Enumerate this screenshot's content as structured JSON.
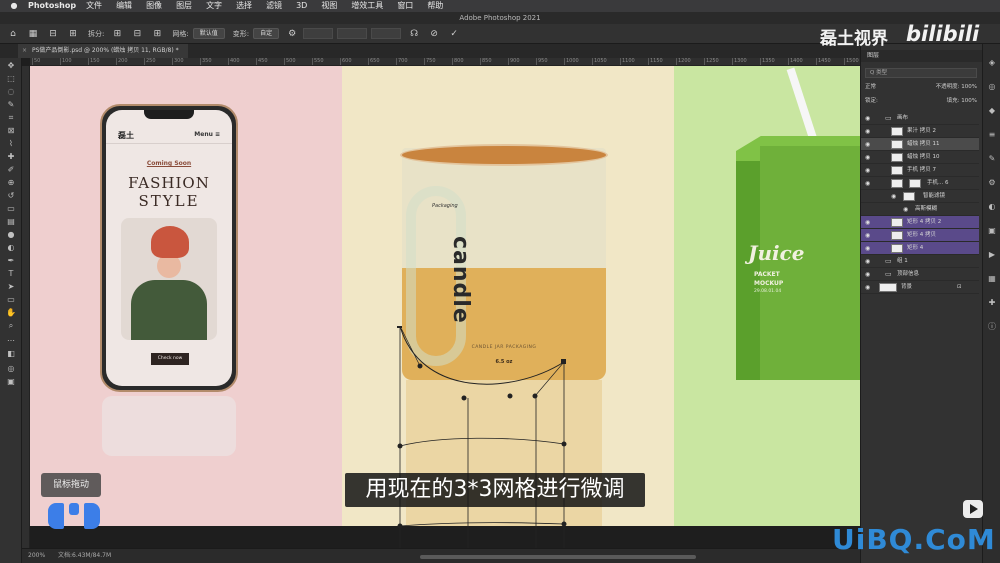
{
  "macbar": {
    "apple": "",
    "app": "Photoshop",
    "menus": [
      "文件",
      "编辑",
      "图像",
      "图层",
      "文字",
      "选择",
      "滤镜",
      "3D",
      "视图",
      "增效工具",
      "窗口",
      "帮助"
    ]
  },
  "window_title": "Adobe Photoshop 2021",
  "options": {
    "split_label": "拆分:",
    "grid_label": "网格:",
    "grid_value": "默认值",
    "warp_label": "变形:",
    "warp_value": "自定"
  },
  "doc_tab": {
    "close": "×",
    "title": "PS做产品倒影.psd @ 200% (蜡烛 拷贝 11, RGB/8) *"
  },
  "ruler_ticks": [
    "50",
    "100",
    "150",
    "200",
    "250",
    "300",
    "350",
    "400",
    "450",
    "500",
    "550",
    "600",
    "650",
    "700",
    "750",
    "800",
    "850",
    "900",
    "950",
    "1000",
    "1050",
    "1100",
    "1150",
    "1200",
    "1250",
    "1300",
    "1350",
    "1400",
    "1450",
    "1500"
  ],
  "phone": {
    "brand": "磊土",
    "menu": "Menu ≡",
    "coming": "Coming Soon",
    "title1": "FASHION",
    "title2": "STYLE",
    "button": "Check now"
  },
  "candle": {
    "script": "Packaging",
    "word": "candle",
    "pack_text": "CANDLE JAR PACKAGING",
    "oz": "6.5 oz"
  },
  "juice": {
    "title": "Juice",
    "sub1": "PACKET",
    "sub2": "MOCKUP",
    "sub3": "29.08.01.04"
  },
  "layers_panel": {
    "title": "图层",
    "search": "Q 类型",
    "blend": "正常",
    "opacity": "不透明度: 100%",
    "lock": "锁定:",
    "fill": "填充: 100%",
    "layers": [
      {
        "name": "画布",
        "kind": "group",
        "state": ""
      },
      {
        "name": "果汁 拷贝 2",
        "kind": "layer",
        "state": ""
      },
      {
        "name": "蜡烛 拷贝 11",
        "kind": "layer",
        "state": "selected"
      },
      {
        "name": "蜡烛 拷贝 10",
        "kind": "layer",
        "state": ""
      },
      {
        "name": "手机 拷贝 7",
        "kind": "layer",
        "state": ""
      },
      {
        "name": "手机... 6",
        "kind": "layer",
        "state": ""
      },
      {
        "name": "智能滤镜",
        "kind": "filter",
        "state": ""
      },
      {
        "name": "高斯模糊",
        "kind": "filter",
        "state": ""
      },
      {
        "name": "矩形 4 拷贝 2",
        "kind": "layer",
        "state": "purple"
      },
      {
        "name": "矩形 4 拷贝",
        "kind": "layer",
        "state": "purple"
      },
      {
        "name": "矩形 4",
        "kind": "layer",
        "state": "purple"
      },
      {
        "name": "组 1",
        "kind": "group",
        "state": ""
      },
      {
        "name": "顶部信息",
        "kind": "group",
        "state": ""
      },
      {
        "name": "背景",
        "kind": "layer",
        "state": ""
      }
    ]
  },
  "status": {
    "zoom": "200%",
    "doc": "文档:6.43M/84.7M"
  },
  "overlay": {
    "subtitle": "用现在的3*3网格进行微调",
    "hint": "鼠标拖动",
    "channel": "磊土视界",
    "bili": "bilibili",
    "site": "UiBQ.CoM"
  },
  "colors": {
    "pink_panel": "#efcfcf",
    "cream_panel": "#f1e7c6",
    "green_panel": "#c9e6a1",
    "selection_purple": "#5a4a8a",
    "accent_blue": "#3c7ee8"
  }
}
